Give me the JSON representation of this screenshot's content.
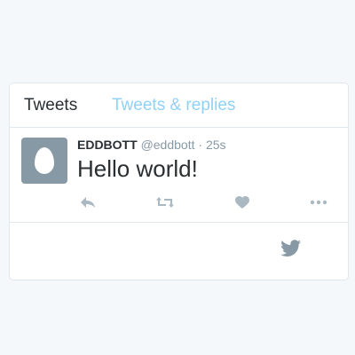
{
  "tabs": {
    "active": "Tweets",
    "inactive": "Tweets & replies"
  },
  "tweet": {
    "name": "EDDBOTT",
    "handle": "@eddbott",
    "separator": "·",
    "time": "25s",
    "text": "Hello world!",
    "avatar_icon": "default-egg-avatar-icon"
  },
  "actions": [
    {
      "name": "reply",
      "icon": "reply-icon"
    },
    {
      "name": "retweet",
      "icon": "retweet-icon"
    },
    {
      "name": "like",
      "icon": "heart-icon"
    },
    {
      "name": "more",
      "icon": "more-icon"
    }
  ],
  "footer": {
    "icon": "twitter-bird-icon"
  },
  "colors": {
    "background": "#f5f8fa",
    "card": "#ffffff",
    "border": "#e1e8ed",
    "text": "#292f33",
    "muted": "#8899a6",
    "inactive_tab": "#8fd2f7",
    "icon": "#aab8c2",
    "bird": "#8899a6"
  }
}
